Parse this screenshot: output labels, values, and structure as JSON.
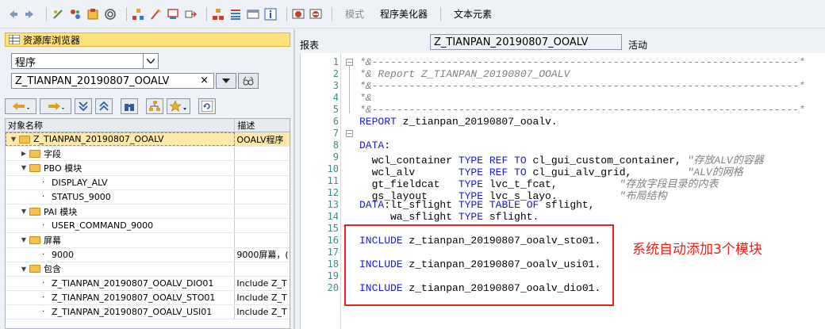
{
  "toolbar": {
    "icons": [
      "back-arrow-icon",
      "forward-arrow-icon",
      "other-object-icon",
      "display-change-icon",
      "activate-icon",
      "where-used-icon",
      "hierarchy-icon",
      "pattern-icon",
      "object-list-icon",
      "navigate-icon",
      "layout-icon",
      "test-icon",
      "breakpoint-icon",
      "info-icon",
      "pretty-printer-icon",
      "stop-icon"
    ],
    "mode_label": "模式",
    "pretty_printer_label": "程序美化器",
    "text_elements_label": "文本元素"
  },
  "left": {
    "title": "资源库浏览器",
    "object_type": "程序",
    "object_name": "Z_TIANPAN_20190807_OOALV",
    "clear_glyph": "×",
    "columns": [
      "对象名称",
      "描述"
    ],
    "rows": [
      {
        "indent": 0,
        "tri": "▼",
        "type": "folder",
        "name": "Z_TIANPAN_20190807_OOALV",
        "desc": "OOALV程序",
        "selected": true
      },
      {
        "indent": 1,
        "tri": "▶",
        "type": "folder",
        "name": "字段",
        "desc": ""
      },
      {
        "indent": 1,
        "tri": "▼",
        "type": "folder",
        "name": "PBO 模块",
        "desc": ""
      },
      {
        "indent": 2,
        "tri": "",
        "type": "dot",
        "name": "DISPLAY_ALV",
        "desc": ""
      },
      {
        "indent": 2,
        "tri": "",
        "type": "dot",
        "name": "STATUS_9000",
        "desc": ""
      },
      {
        "indent": 1,
        "tri": "▼",
        "type": "folder",
        "name": "PAI 模块",
        "desc": ""
      },
      {
        "indent": 2,
        "tri": "",
        "type": "dot",
        "name": "USER_COMMAND_9000",
        "desc": ""
      },
      {
        "indent": 1,
        "tri": "▼",
        "type": "folder",
        "name": "屏幕",
        "desc": ""
      },
      {
        "indent": 2,
        "tri": "",
        "type": "dot",
        "name": "9000",
        "desc": "9000屏幕，("
      },
      {
        "indent": 1,
        "tri": "▼",
        "type": "folder",
        "name": "包含",
        "desc": ""
      },
      {
        "indent": 2,
        "tri": "",
        "type": "dot",
        "name": "Z_TIANPAN_20190807_OOALV_DIO01",
        "desc": "Include Z_T"
      },
      {
        "indent": 2,
        "tri": "",
        "type": "dot",
        "name": "Z_TIANPAN_20190807_OOALV_STO01",
        "desc": "Include Z_T"
      },
      {
        "indent": 2,
        "tri": "",
        "type": "dot",
        "name": "Z_TIANPAN_20190807_OOALV_USI01",
        "desc": "Include Z_T"
      }
    ]
  },
  "right": {
    "report_label": "报表",
    "report_name": "Z_TIANPAN_20190807_OOALV",
    "status": "活动",
    "annotation": "系统自动添加3个模块",
    "lines": [
      {
        "n": "1",
        "text": "*&---------------------------------------------------------------------*"
      },
      {
        "n": "2",
        "text": "*& Report Z_TIANPAN_20190807_OOALV"
      },
      {
        "n": "3",
        "text": "*&---------------------------------------------------------------------*"
      },
      {
        "n": "4",
        "text": "*&"
      },
      {
        "n": "5",
        "text": "*&---------------------------------------------------------------------*"
      },
      {
        "n": "6",
        "text": "REPORT z_tianpan_20190807_ooalv."
      },
      {
        "n": "7",
        "text": ""
      },
      {
        "n": "8",
        "text": "DATA:"
      },
      {
        "n": "9",
        "text": "  wcl_container TYPE REF TO cl_gui_custom_container, \"存放ALV的容器"
      },
      {
        "n": "10",
        "text": "  wcl_alv       TYPE REF TO cl_gui_alv_grid,         \"ALV的网格"
      },
      {
        "n": "11",
        "text": "  gt_fieldcat   TYPE lvc_t_fcat,          \"存放字段目录的内表"
      },
      {
        "n": "12",
        "text": "  gs_layout     TYPE lvc_s_layo.          \"布局结构"
      },
      {
        "n": "13",
        "text": "DATA:lt_sflight TYPE TABLE OF sflight,"
      },
      {
        "n": "14",
        "text": "     wa_sflight TYPE sflight."
      },
      {
        "n": "15",
        "text": ""
      },
      {
        "n": "16",
        "text": "INCLUDE z_tianpan_20190807_ooalv_sto01."
      },
      {
        "n": "17",
        "text": ""
      },
      {
        "n": "18",
        "text": "INCLUDE z_tianpan_20190807_ooalv_usi01."
      },
      {
        "n": "19",
        "text": ""
      },
      {
        "n": "20",
        "text": "INCLUDE z_tianpan_20190807_ooalv_dio01."
      }
    ]
  }
}
